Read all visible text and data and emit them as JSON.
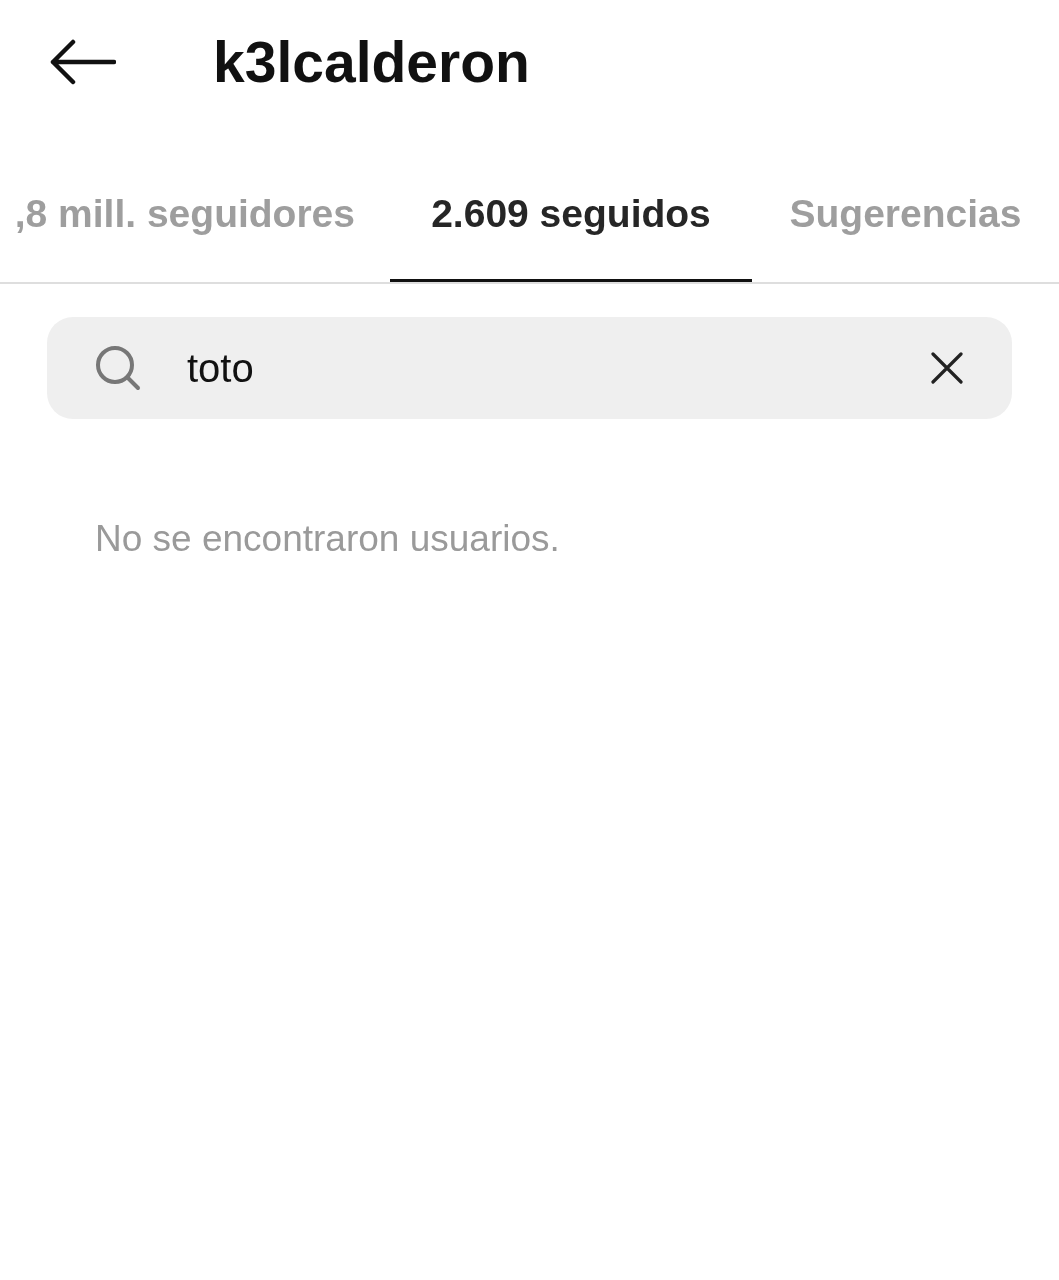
{
  "header": {
    "title": "k3lcalderon"
  },
  "tabs": [
    {
      "label": ",8 mill. seguidores",
      "selected": false
    },
    {
      "label": "2.609 seguidos",
      "selected": true
    },
    {
      "label": "Sugerencias",
      "selected": false
    }
  ],
  "search": {
    "value": "toto"
  },
  "empty_message": "No se encontraron usuarios."
}
